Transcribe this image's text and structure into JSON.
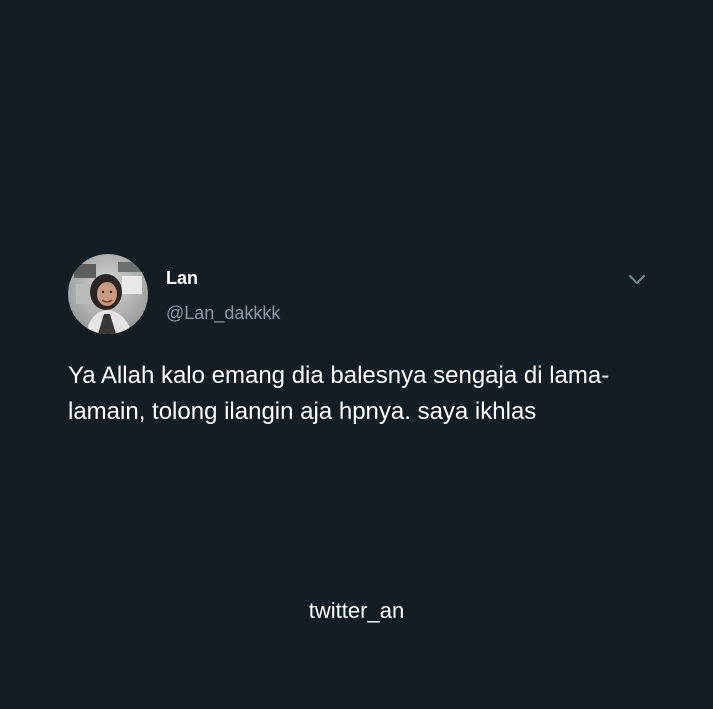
{
  "tweet": {
    "display_name": "Lan",
    "handle": "@Lan_dakkkk",
    "text": "Ya Allah kalo emang dia balesnya sengaja di lama-lamain, tolong ilangin aja hpnya. saya ikhlas",
    "more_icon": "chevron-down-icon",
    "avatar": "avatar-photo"
  },
  "watermark": {
    "text": "twitter_an"
  },
  "colors": {
    "background": "#141d24",
    "primary_text": "#ffffff",
    "secondary_text": "#8899a6",
    "icon": "#6e7f8d"
  }
}
